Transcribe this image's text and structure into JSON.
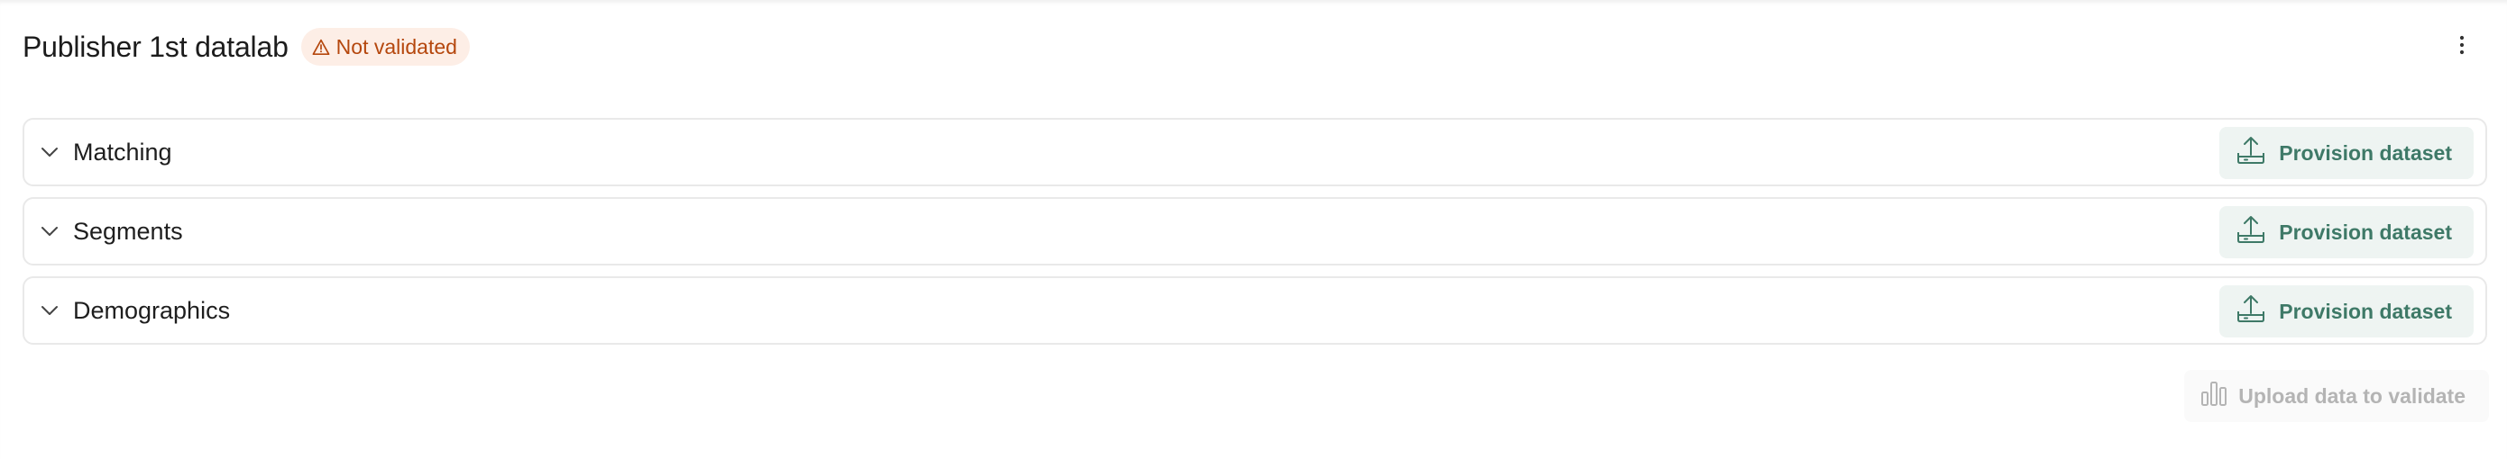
{
  "header": {
    "title": "Publisher 1st datalab",
    "badge": "Not validated"
  },
  "sections": [
    {
      "label": "Matching",
      "action": "Provision dataset"
    },
    {
      "label": "Segments",
      "action": "Provision dataset"
    },
    {
      "label": "Demographics",
      "action": "Provision dataset"
    }
  ],
  "footer": {
    "upload_label": "Upload data to validate"
  },
  "colors": {
    "badge_text": "#b5470d",
    "badge_bg": "#fdeee6",
    "action_text": "#3e7967",
    "action_bg": "#eef4f2",
    "disabled_text": "#b4b4b4"
  },
  "icons": {
    "badge": "warning-triangle-icon",
    "more": "more-vertical-icon",
    "section_toggle": "chevron-down-icon",
    "provision": "upload-tray-icon",
    "upload": "bar-chart-icon"
  }
}
